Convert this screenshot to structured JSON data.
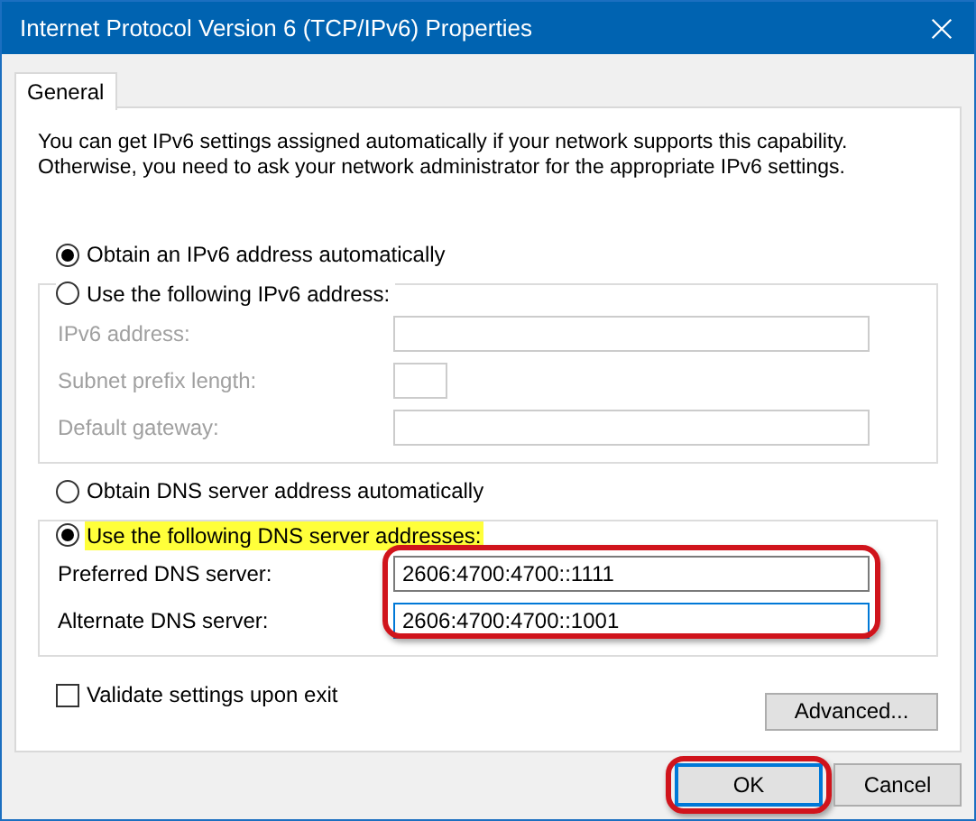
{
  "window": {
    "title": "Internet Protocol Version 6 (TCP/IPv6) Properties"
  },
  "tabs": [
    {
      "label": "General",
      "selected": true
    }
  ],
  "description": "You can get IPv6 settings assigned automatically if your network supports this capability.\nOtherwise, you need to ask your network administrator for the appropriate IPv6 settings.",
  "address_options": [
    {
      "label": "Obtain an IPv6 address automatically",
      "selected": true,
      "highlighted": false
    },
    {
      "label": "Use the following IPv6 address:",
      "selected": false,
      "highlighted": false
    }
  ],
  "address_fields": [
    {
      "label": "IPv6 address:",
      "disabled": true,
      "kind": "wide"
    },
    {
      "label": "Subnet prefix length:",
      "disabled": true,
      "kind": "narrow"
    },
    {
      "label": "Default gateway:",
      "disabled": true,
      "kind": "wide"
    }
  ],
  "dns_options": [
    {
      "label": "Obtain DNS server address automatically",
      "selected": false,
      "highlighted": false
    },
    {
      "label": "Use the following DNS server addresses:",
      "selected": true,
      "highlighted": true
    }
  ],
  "dns_fields": [
    {
      "label": "Preferred DNS server:",
      "value": "2606:4700:4700::1111",
      "disabled": false,
      "kind": "wide",
      "focused": false
    },
    {
      "label": "Alternate DNS server:",
      "value": "2606:4700:4700::1001",
      "disabled": false,
      "kind": "wide",
      "focused": true
    }
  ],
  "dns_fields_annotated": true,
  "validate": {
    "label": "Validate settings upon exit",
    "checked": false
  },
  "advanced_button": "Advanced...",
  "buttons": [
    {
      "label": "OK",
      "default": true,
      "annotated": true
    },
    {
      "label": "Cancel",
      "default": false,
      "annotated": false
    }
  ]
}
